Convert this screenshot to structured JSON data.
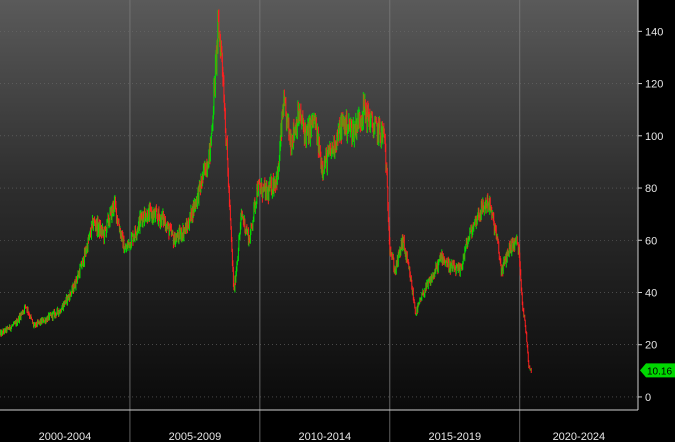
{
  "chart_data": {
    "type": "candlestick",
    "title": "",
    "xlabel": "",
    "ylabel": "",
    "ylim": [
      -5,
      152
    ],
    "xlim": [
      2000.0,
      2024.55
    ],
    "y_ticks": [
      0,
      20,
      40,
      60,
      80,
      100,
      120,
      140
    ],
    "y_axis_position": "right",
    "x_groups": [
      {
        "label": "2000-2004",
        "start": 2000,
        "end": 2005
      },
      {
        "label": "2005-2009",
        "start": 2005,
        "end": 2010
      },
      {
        "label": "2010-2014",
        "start": 2010,
        "end": 2015
      },
      {
        "label": "2015-2019",
        "start": 2015,
        "end": 2020
      },
      {
        "label": "2020-2024",
        "start": 2020,
        "end": 2025
      }
    ],
    "last_value": "10.16",
    "up_color": "#00e000",
    "down_color": "#ff2020",
    "last_tag_color": "#00d800",
    "grid": "horizontal dotted",
    "anchors": [
      [
        2000.0,
        24
      ],
      [
        2000.6,
        28
      ],
      [
        2001.0,
        35
      ],
      [
        2001.3,
        27
      ],
      [
        2001.8,
        30
      ],
      [
        2002.3,
        33
      ],
      [
        2002.8,
        41
      ],
      [
        2003.2,
        52
      ],
      [
        2003.6,
        67
      ],
      [
        2004.0,
        62
      ],
      [
        2004.4,
        74
      ],
      [
        2004.8,
        56
      ],
      [
        2005.2,
        63
      ],
      [
        2005.5,
        70
      ],
      [
        2005.8,
        70
      ],
      [
        2006.3,
        68
      ],
      [
        2006.7,
        60
      ],
      [
        2007.2,
        65
      ],
      [
        2007.7,
        80
      ],
      [
        2008.1,
        95
      ],
      [
        2008.4,
        142
      ],
      [
        2008.55,
        130
      ],
      [
        2009.0,
        40
      ],
      [
        2009.3,
        70
      ],
      [
        2009.6,
        60
      ],
      [
        2009.9,
        80
      ],
      [
        2010.3,
        78
      ],
      [
        2010.7,
        85
      ],
      [
        2010.9,
        112
      ],
      [
        2011.2,
        98
      ],
      [
        2011.5,
        108
      ],
      [
        2011.8,
        100
      ],
      [
        2012.1,
        106
      ],
      [
        2012.4,
        88
      ],
      [
        2012.8,
        95
      ],
      [
        2013.2,
        105
      ],
      [
        2013.6,
        102
      ],
      [
        2014.0,
        110
      ],
      [
        2014.4,
        103
      ],
      [
        2014.8,
        100
      ],
      [
        2015.0,
        58
      ],
      [
        2015.2,
        48
      ],
      [
        2015.5,
        60
      ],
      [
        2015.8,
        45
      ],
      [
        2016.0,
        32
      ],
      [
        2016.3,
        40
      ],
      [
        2016.7,
        47
      ],
      [
        2017.0,
        54
      ],
      [
        2017.3,
        50
      ],
      [
        2017.7,
        48
      ],
      [
        2018.0,
        60
      ],
      [
        2018.4,
        70
      ],
      [
        2018.8,
        75
      ],
      [
        2019.1,
        62
      ],
      [
        2019.3,
        48
      ],
      [
        2019.6,
        57
      ],
      [
        2019.9,
        60
      ],
      [
        2020.0,
        52
      ],
      [
        2020.1,
        36
      ],
      [
        2020.25,
        24
      ],
      [
        2020.35,
        12
      ],
      [
        2020.45,
        10.16
      ]
    ]
  }
}
